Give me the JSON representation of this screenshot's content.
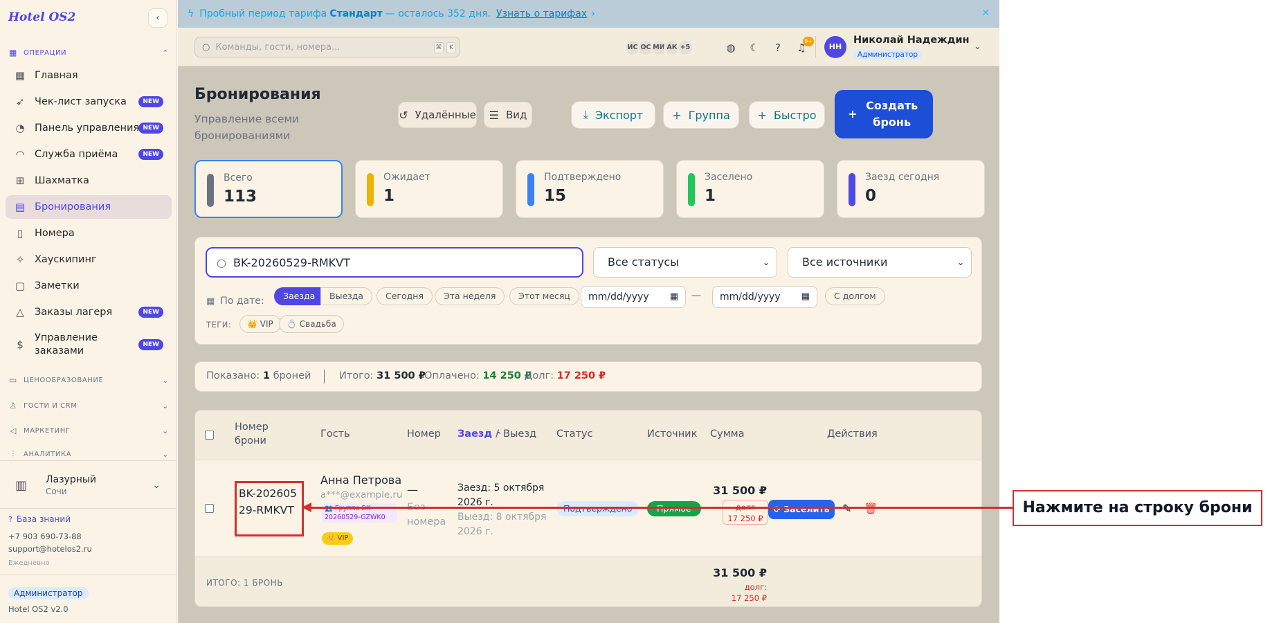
{
  "app": {
    "brand": "Hotel OS2"
  },
  "sidebar": {
    "section_ops": "ОПЕРАЦИИ",
    "items": [
      {
        "label": "Главная",
        "icon": "dashboard-icon"
      },
      {
        "label": "Чек-лист запуска",
        "icon": "rocket-icon",
        "badge": "NEW"
      },
      {
        "label": "Панель управления",
        "icon": "gauge-icon",
        "badge": "NEW"
      },
      {
        "label": "Служба приёма",
        "icon": "bell-icon",
        "badge": "NEW"
      },
      {
        "label": "Шахматка",
        "icon": "grid-icon"
      },
      {
        "label": "Бронирования",
        "icon": "clipboard-icon",
        "active": true
      },
      {
        "label": "Номера",
        "icon": "door-icon"
      },
      {
        "label": "Хаускипинг",
        "icon": "sparkle-icon"
      },
      {
        "label": "Заметки",
        "icon": "note-icon"
      },
      {
        "label": "Заказы лагеря",
        "icon": "tent-icon",
        "badge": "NEW"
      },
      {
        "label": "Управление заказами",
        "icon": "receipt-icon",
        "badge": "NEW"
      }
    ],
    "sections": [
      "ЦЕНООБРАЗОВАНИЕ",
      "ГОСТИ И CRM",
      "МАРКЕТИНГ",
      "АНАЛИТИКА"
    ],
    "hotel": {
      "name": "Лазурный",
      "city": "Сочи"
    },
    "kb": "База знаний",
    "phone": "+7 903 690-73-88",
    "email": "support@hotelos2.ru",
    "hours": "Ежедневно",
    "role": "Администратор",
    "version": "Hotel OS2 v2.0"
  },
  "banner": {
    "prefix": "Пробный период тарифа",
    "plan": "Стандарт",
    "suffix": "— осталось 352 дня.",
    "link": "Узнать о тарифах"
  },
  "topbar": {
    "search_placeholder": "Команды, гости, номера...",
    "kbd1": "⌘",
    "kbd2": "K",
    "avatars": [
      "ИС",
      "ОС",
      "МИ",
      "АК"
    ],
    "more": "+5",
    "notif_count": "9+",
    "user_initials": "НН",
    "user_name": "Николай Надеждин",
    "user_role": "Администратор"
  },
  "page": {
    "title": "Бронирования",
    "subtitle": "Управление всеми бронированиями",
    "buttons": {
      "deleted": "Удалённые",
      "view": "Вид",
      "export": "Экспорт",
      "group": "Группа",
      "quick": "Быстро",
      "create": "Создать бронь"
    }
  },
  "stats": [
    {
      "label": "Всего",
      "value": "113",
      "color": "#6b7280"
    },
    {
      "label": "Ожидает",
      "value": "1",
      "color": "#eab308"
    },
    {
      "label": "Подтверждено",
      "value": "15",
      "color": "#3b82f6"
    },
    {
      "label": "Заселено",
      "value": "1",
      "color": "#22c55e"
    },
    {
      "label": "Заезд сегодня",
      "value": "0",
      "color": "#4f46e5"
    }
  ],
  "filters": {
    "search_value": "BK-20260529-RMKVT",
    "status": "Все статусы",
    "source": "Все источники",
    "by_date": "По дате:",
    "checkin": "Заезда",
    "checkout": "Выезда",
    "today": "Сегодня",
    "week": "Эта неделя",
    "month": "Этот месяц",
    "date_placeholder": "mm/dd/yyyy",
    "dash": "—",
    "with_debt": "С долгом",
    "tags_label": "ТЕГИ:",
    "tag_vip": "👑 VIP",
    "tag_wedding": "💍 Свадьба"
  },
  "summary": {
    "shown_label": "Показано:",
    "shown_count": "1",
    "shown_unit": "броней",
    "total_label": "Итого:",
    "total": "31 500 ₽",
    "paid_label": "Оплачено:",
    "paid": "14 250 ₽",
    "debt_label": "Долг:",
    "debt": "17 250 ₽"
  },
  "table": {
    "headers": {
      "number": "Номер брони",
      "guest": "Гость",
      "room": "Номер",
      "checkin": "Заезд",
      "slash": "/",
      "checkout": "Выезд",
      "status": "Статус",
      "source": "Источник",
      "sum": "Сумма",
      "actions": "Действия"
    },
    "row": {
      "id": "BK-20260529-RMKVT",
      "guest": "Анна Петрова",
      "email": "a***@example.ru",
      "group": "👥 Группа BK-20260529-GZWK0",
      "vip": "👑 VIP",
      "room": "—",
      "room_none": "Без номера",
      "checkin": "Заезд: 5 октября 2026 г.",
      "checkout": "Выезд: 8 октября 2026 г.",
      "status": "Подтверждено",
      "source": "Прямое",
      "amount": "31 500 ₽",
      "debt_label": "долг",
      "debt": "17 250 ₽",
      "action": "Заселить"
    },
    "footer": {
      "label": "ИТОГО: 1 БРОНЬ",
      "amount": "31 500 ₽",
      "debt_label": "долг:",
      "debt": "17 250 ₽"
    }
  },
  "annotation": {
    "text": "Нажмите на строку брони"
  }
}
